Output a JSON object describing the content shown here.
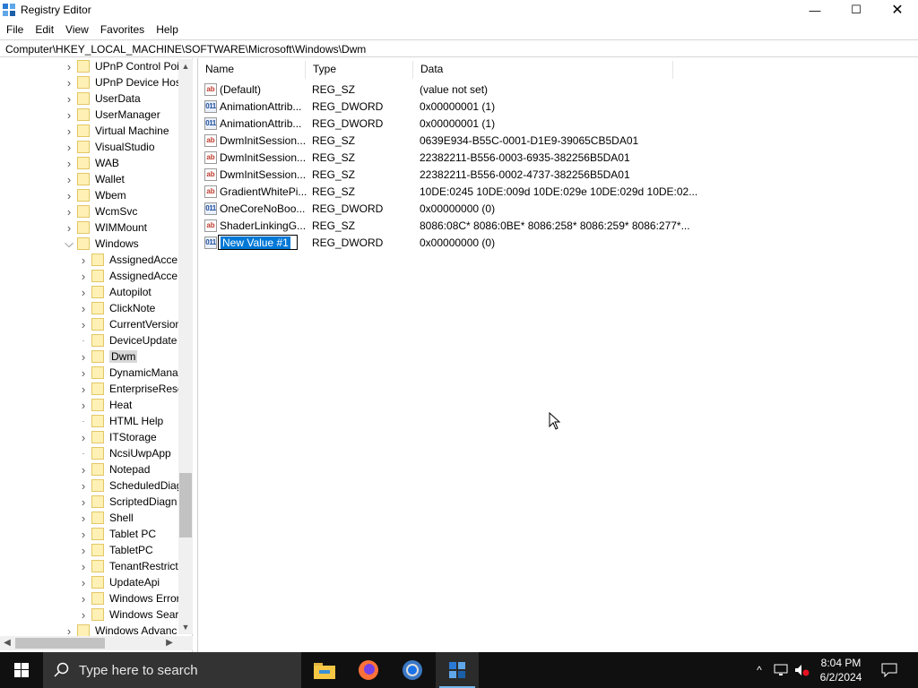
{
  "window": {
    "title": "Registry Editor",
    "controls": {
      "minimize": "—",
      "maximize": "☐",
      "close": "✕"
    }
  },
  "menu": [
    "File",
    "Edit",
    "View",
    "Favorites",
    "Help"
  ],
  "address": "Computer\\HKEY_LOCAL_MACHINE\\SOFTWARE\\Microsoft\\Windows\\Dwm",
  "tree": {
    "parent_items": [
      "UPnP Control Poi",
      "UPnP Device Hos",
      "UserData",
      "UserManager",
      "Virtual Machine",
      "VisualStudio",
      "WAB",
      "Wallet",
      "Wbem",
      "WcmSvc",
      "WIMMount"
    ],
    "expanded_item": "Windows",
    "child_items": [
      "AssignedAcce",
      "AssignedAcce",
      "Autopilot",
      "ClickNote",
      "CurrentVersion",
      "DeviceUpdate",
      "Dwm",
      "DynamicMana",
      "EnterpriseResc",
      "Heat",
      "HTML Help",
      "ITStorage",
      "NcsiUwpApp",
      "Notepad",
      "ScheduledDiag",
      "ScriptedDiagn",
      "Shell",
      "Tablet PC",
      "TabletPC",
      "TenantRestrict",
      "UpdateApi",
      "Windows Error",
      "Windows Sear"
    ],
    "after_item": "Windows Advanc",
    "selected": "Dwm"
  },
  "list": {
    "columns": {
      "name": "Name",
      "type": "Type",
      "data": "Data"
    },
    "rows": [
      {
        "icon": "string-value-icon",
        "name": "(Default)",
        "type": "REG_SZ",
        "data": "(value not set)"
      },
      {
        "icon": "dword-value-icon",
        "name": "AnimationAttrib...",
        "type": "REG_DWORD",
        "data": "0x00000001 (1)"
      },
      {
        "icon": "dword-value-icon",
        "name": "AnimationAttrib...",
        "type": "REG_DWORD",
        "data": "0x00000001 (1)"
      },
      {
        "icon": "string-value-icon",
        "name": "DwmInitSession...",
        "type": "REG_SZ",
        "data": "0639E934-B55C-0001-D1E9-39065CB5DA01"
      },
      {
        "icon": "string-value-icon",
        "name": "DwmInitSession...",
        "type": "REG_SZ",
        "data": "22382211-B556-0003-6935-382256B5DA01"
      },
      {
        "icon": "string-value-icon",
        "name": "DwmInitSession...",
        "type": "REG_SZ",
        "data": "22382211-B556-0002-4737-382256B5DA01"
      },
      {
        "icon": "string-value-icon",
        "name": "GradientWhitePi...",
        "type": "REG_SZ",
        "data": "10DE:0245 10DE:009d 10DE:029e 10DE:029d 10DE:02..."
      },
      {
        "icon": "dword-value-icon",
        "name": "OneCoreNoBoo...",
        "type": "REG_DWORD",
        "data": "0x00000000 (0)"
      },
      {
        "icon": "string-value-icon",
        "name": "ShaderLinkingG...",
        "type": "REG_SZ",
        "data": "8086:08C* 8086:0BE* 8086:258* 8086:259* 8086:277*..."
      }
    ],
    "editing_row": {
      "icon": "dword-value-icon",
      "name": "New Value #1",
      "type": "REG_DWORD",
      "data": "0x00000000 (0)"
    }
  },
  "icon_text": {
    "string": "ab",
    "dword": "011"
  },
  "taskbar": {
    "search_placeholder": "Type here to search",
    "apps": [
      "file-explorer-icon",
      "firefox-icon",
      "chrome-icon",
      "registry-editor-icon"
    ],
    "time": "8:04 PM",
    "date": "6/2/2024"
  },
  "colors": {
    "accent": "#0078d7",
    "taskbar": "#101010",
    "folder": "#fff1b5"
  }
}
